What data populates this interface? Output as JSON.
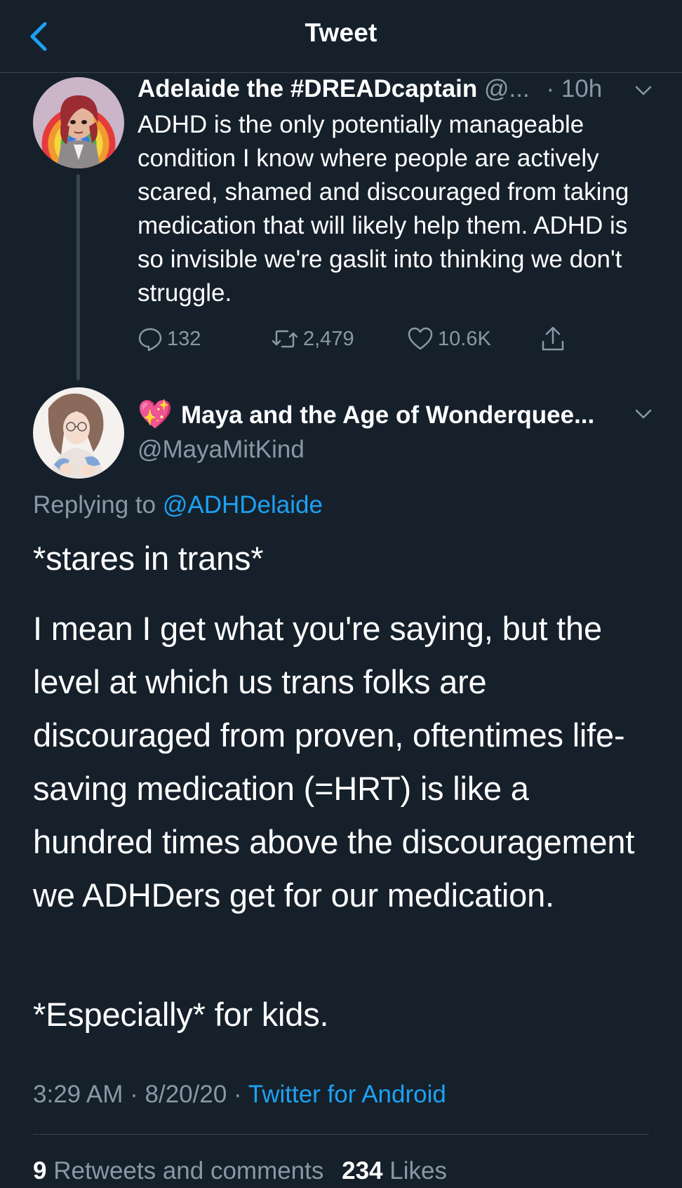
{
  "header": {
    "title": "Tweet"
  },
  "parent_tweet": {
    "name": "Adelaide the #DREADcaptain",
    "handle": "@...",
    "time": "· 10h",
    "text": "ADHD is the only potentially manageable condition I know where people are actively scared, shamed and discouraged from taking medication that will likely help them. ADHD is so invisible we're gaslit into thinking we don't struggle.",
    "replies": "132",
    "retweets": "2,479",
    "likes": "10.6K"
  },
  "main_tweet": {
    "emoji": "💖",
    "name": "Maya and the Age of Wonderquee...",
    "handle": "@MayaMitKind",
    "replying_prefix": "Replying to",
    "replying_to": "@ADHDelaide",
    "paragraphs": [
      "*stares in trans*",
      "I mean I get what you're saying, but the level at which us trans folks are discouraged from proven, oftentimes life-saving medication (=HRT) is like a hundred times above the discouragement we ADHDers get for our medication.",
      "*Especially* for kids."
    ],
    "timestamp": "3:29 AM · 8/20/20 ·",
    "source": "Twitter for Android",
    "retweets_count": "9",
    "retweets_label": "Retweets and comments",
    "likes_count": "234",
    "likes_label": "Likes"
  },
  "colors": {
    "background": "#15202b",
    "muted": "#8899a6",
    "accent": "#1da1f2",
    "divider": "#38444d"
  }
}
